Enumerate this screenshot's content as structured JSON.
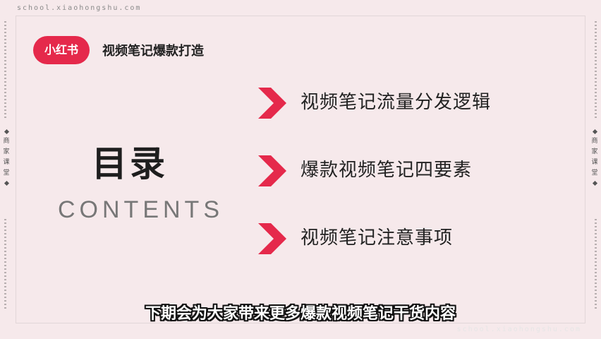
{
  "site": {
    "url_top": "school.xiaohongshu.com",
    "url_bottom": "school.xiaohongshu.com"
  },
  "side_label": [
    "商",
    "家",
    "课",
    "堂"
  ],
  "brand": {
    "logo_text": "小红书",
    "accent_color": "#e5294b"
  },
  "header": {
    "title": "视频笔记爆款打造"
  },
  "toc": {
    "title": "目录",
    "subtitle": "CONTENTS",
    "items": [
      {
        "label": "视频笔记流量分发逻辑",
        "icon": "chevron-right-icon"
      },
      {
        "label": "爆款视频笔记四要素",
        "icon": "chevron-right-icon"
      },
      {
        "label": "视频笔记注意事项",
        "icon": "chevron-right-icon"
      }
    ]
  },
  "caption": {
    "text": "下期会为大家带来更多爆款视频笔记干货内容"
  }
}
